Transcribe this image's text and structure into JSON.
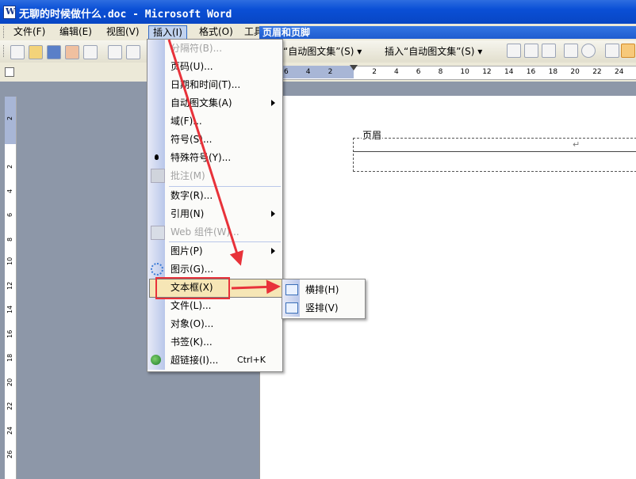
{
  "window": {
    "title": "无聊的时候做什么.doc - Microsoft Word"
  },
  "menubar": [
    {
      "label": "文件(F)"
    },
    {
      "label": "编辑(E)"
    },
    {
      "label": "视图(V)"
    },
    {
      "label": "插入(I)"
    },
    {
      "label": "格式(O)"
    },
    {
      "label": "工具"
    }
  ],
  "header_footer_toolbar": {
    "title": "页眉和页脚",
    "insert_autotext_1": "“自动图文集”(S) ▾",
    "insert_autotext_2": "插入“自动图文集”(S) ▾"
  },
  "ruler": {
    "h_ticks": [
      "6",
      "4",
      "2",
      "",
      "2",
      "4",
      "6",
      "8",
      "10",
      "12",
      "14",
      "16",
      "18",
      "20",
      "22",
      "24"
    ],
    "v_ticks": [
      "2",
      "",
      "2",
      "4",
      "6",
      "8",
      "10",
      "12",
      "14",
      "16",
      "18",
      "20",
      "22",
      "24",
      "26"
    ]
  },
  "document": {
    "header_label": "页眉",
    "paragraph_mark": "↵"
  },
  "insert_menu": {
    "items": [
      {
        "label": "分隔符(B)...",
        "disabled": true
      },
      {
        "label": "页码(U)...",
        "disabled": false
      },
      {
        "label": "日期和时间(T)...",
        "disabled": false
      },
      {
        "label": "自动图文集(A)",
        "disabled": false,
        "submenu": true
      },
      {
        "label": "域(F)...",
        "disabled": false
      },
      {
        "label": "符号(S)...",
        "disabled": false
      },
      {
        "label": "特殊符号(Y)...",
        "disabled": false
      },
      {
        "label": "批注(M)",
        "disabled": true
      },
      {
        "label": "数字(R)...",
        "disabled": false
      },
      {
        "label": "引用(N)",
        "disabled": false,
        "submenu": true
      },
      {
        "label": "Web 组件(W)...",
        "disabled": true
      },
      {
        "label": "图片(P)",
        "disabled": false,
        "submenu": true
      },
      {
        "label": "图示(G)...",
        "disabled": false
      },
      {
        "label": "文本框(X)",
        "disabled": false,
        "submenu": true,
        "highlighted": true
      },
      {
        "label": "文件(L)...",
        "disabled": false
      },
      {
        "label": "对象(O)...",
        "disabled": false
      },
      {
        "label": "书签(K)...",
        "disabled": false
      },
      {
        "label": "超链接(I)...",
        "disabled": false,
        "shortcut": "Ctrl+K"
      }
    ]
  },
  "textbox_submenu": {
    "items": [
      {
        "label": "横排(H)"
      },
      {
        "label": "竖排(V)"
      }
    ]
  },
  "annotation_color": "#e8323a"
}
